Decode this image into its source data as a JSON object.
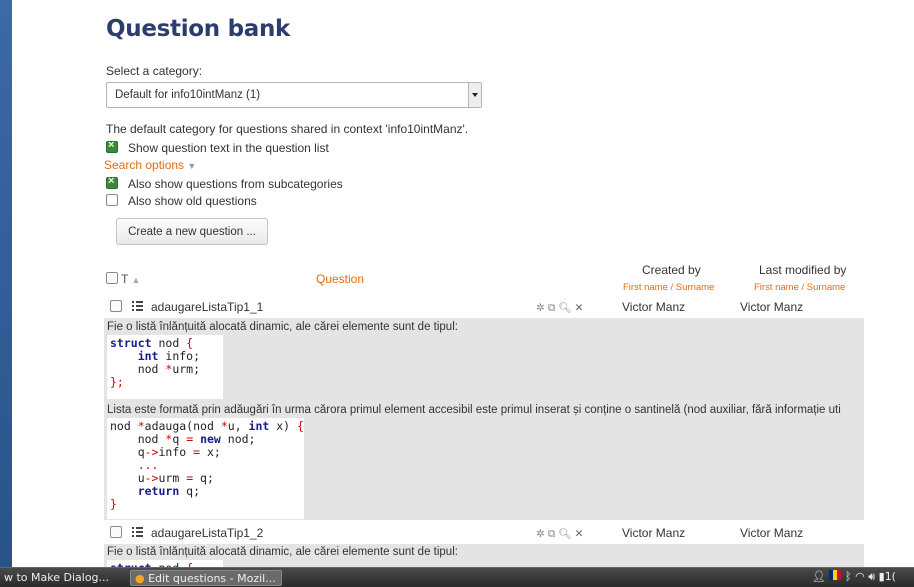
{
  "header": {
    "title": "Question bank"
  },
  "category": {
    "label": "Select a category:",
    "selected": "Default for info10intManz (1)",
    "description": "The default category for questions shared in context 'info10intManz'."
  },
  "options": {
    "show_text_label": "Show question text in the question list",
    "search_options_label": "Search options",
    "subcategories_label": "Also show questions from subcategories",
    "old_questions_label": "Also show old questions"
  },
  "create_button": "Create a new question ...",
  "table": {
    "col_type": "T",
    "col_question": "Question",
    "col_created": "Created by",
    "col_modified": "Last modified by",
    "name_sort_created": "First name / Surname",
    "name_sort_modified": "First name / Surname"
  },
  "questions": [
    {
      "name": "adaugareListaTip1_1",
      "created_by": "Victor Manz",
      "modified_by": "Victor Manz",
      "text_intro": "Fie o listă înlănțuită alocată dinamic, ale cărei elemente sunt de tipul:",
      "text_body": "Lista este formată prin adăugări în urma cărora primul element accesibil este primul inserat și conține o santinelă (nod auxiliar, fără informație uti"
    },
    {
      "name": "adaugareListaTip1_2",
      "created_by": "Victor Manz",
      "modified_by": "Victor Manz",
      "text_intro": "Fie o listă înlănțuită alocată dinamic, ale cărei elemente sunt de tipul:"
    }
  ],
  "taskbar": {
    "task1": "w to Make Dialog...",
    "task2": "Edit questions - Mozil...",
    "clock": "1("
  }
}
